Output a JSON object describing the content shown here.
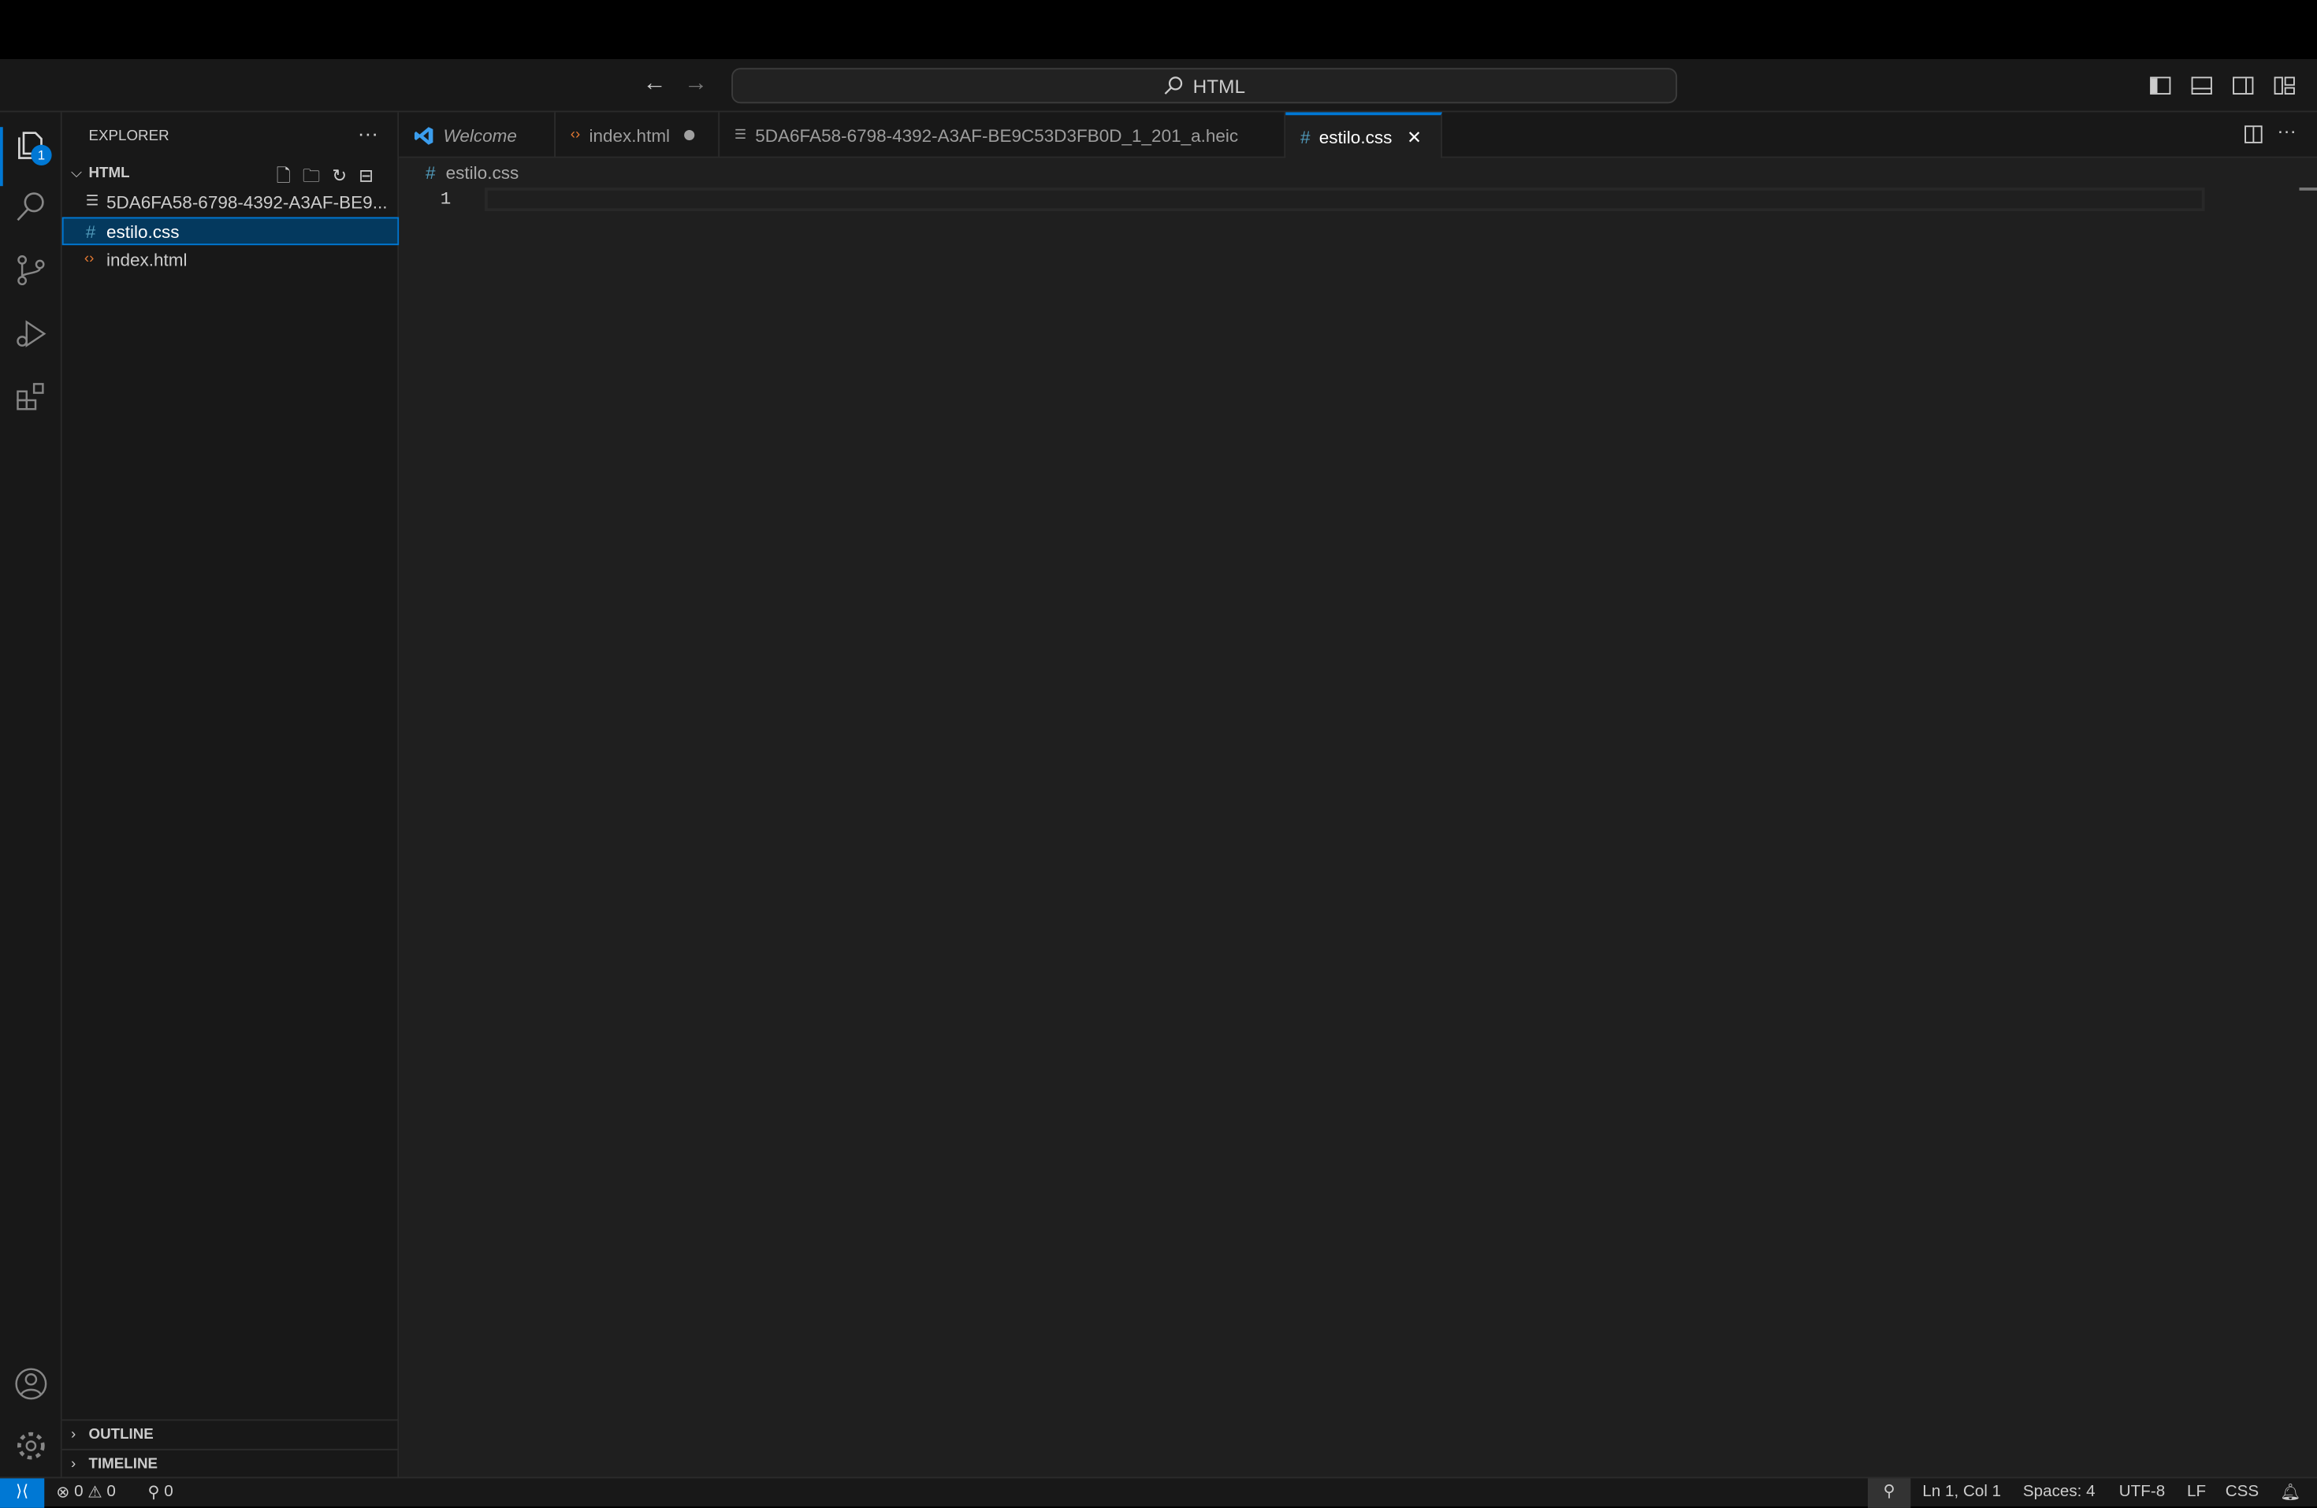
{
  "titlebar": {
    "search_text": "HTML"
  },
  "activity": {
    "explorer_badge": "1"
  },
  "sidebar": {
    "title": "EXPLORER",
    "folder": "HTML",
    "files": [
      {
        "name": "5DA6FA58-6798-4392-A3AF-BE9...",
        "icon": "image-file-icon"
      },
      {
        "name": "estilo.css",
        "icon": "css-hash-icon",
        "selected": true
      },
      {
        "name": "index.html",
        "icon": "html-brackets-icon"
      }
    ],
    "outline": "OUTLINE",
    "timeline": "TIMELINE"
  },
  "tabs": [
    {
      "label": "Welcome"
    },
    {
      "label": "index.html",
      "modified": true
    },
    {
      "label": "5DA6FA58-6798-4392-A3AF-BE9C53D3FB0D_1_201_a.heic"
    },
    {
      "label": "estilo.css",
      "active": true
    }
  ],
  "editor": {
    "breadcrumb": "estilo.css",
    "line_numbers": [
      "1"
    ]
  },
  "status": {
    "errors": "0",
    "warnings": "0",
    "ports": "0",
    "position": "Ln 1, Col 1",
    "spaces": "Spaces: 4",
    "encoding": "UTF-8",
    "eol": "LF",
    "language": "CSS"
  },
  "colors": {
    "accent": "#0078d4",
    "css": "#519aba",
    "html": "#e37933"
  }
}
